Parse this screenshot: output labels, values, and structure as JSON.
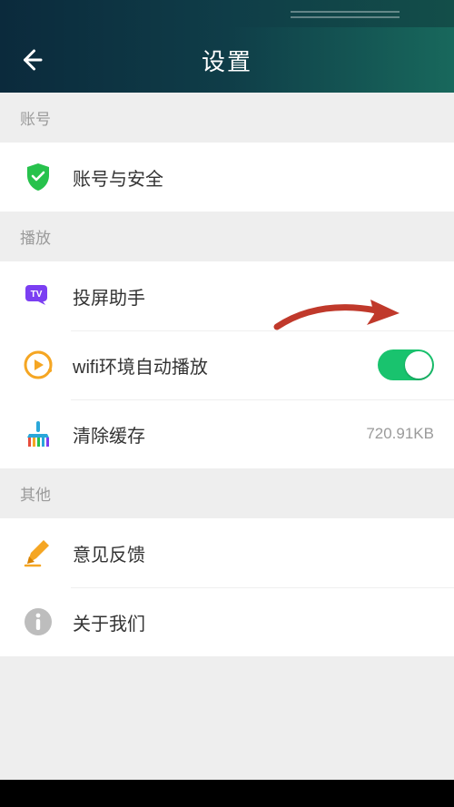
{
  "header": {
    "title": "设置"
  },
  "sections": {
    "account": {
      "header": "账号"
    },
    "playback": {
      "header": "播放"
    },
    "other": {
      "header": "其他"
    }
  },
  "rows": {
    "account_security": {
      "label": "账号与安全"
    },
    "cast_helper": {
      "label": "投屏助手"
    },
    "wifi_autoplay": {
      "label": "wifi环境自动播放",
      "toggle_on": true
    },
    "clear_cache": {
      "label": "清除缓存",
      "value": "720.91KB"
    },
    "feedback": {
      "label": "意见反馈"
    },
    "about": {
      "label": "关于我们"
    }
  }
}
